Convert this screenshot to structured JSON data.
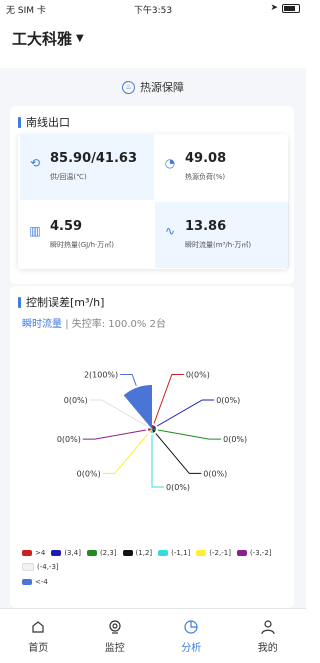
{
  "status": {
    "carrier": "无 SIM 卡",
    "time": "下午3:53"
  },
  "header": {
    "title": "工大科雅"
  },
  "section": {
    "title": "热源保障"
  },
  "station": {
    "title": "南线出口",
    "metrics": [
      {
        "value": "85.90/41.63",
        "label": "供/回温(℃)",
        "icon": "refresh-icon"
      },
      {
        "value": "49.08",
        "label": "热源负荷(%)",
        "icon": "gauge-icon"
      },
      {
        "value": "4.59",
        "label": "瞬时热量(GJ/h·万㎡)",
        "icon": "bar-chart-icon"
      },
      {
        "value": "13.86",
        "label": "瞬时流量(m³/h·万㎡)",
        "icon": "pulse-icon"
      }
    ]
  },
  "control": {
    "title": "控制误差[m³/h]",
    "subtitle_active": "瞬时流量",
    "subtitle_rest": "| 失控率: 100.0% 2台"
  },
  "chart_data": {
    "type": "pie",
    "title": "控制误差[m³/h]",
    "categories": [
      ">4",
      "(3,4]",
      "(2,3]",
      "(1,2]",
      "(-1,1]",
      "(-2,-1]",
      "(-3,-2]",
      "(-4,-3]",
      "<-4"
    ],
    "values": [
      0,
      0,
      0,
      0,
      0,
      0,
      0,
      0,
      2
    ],
    "labels": [
      "0(0%)",
      "0(0%)",
      "0(0%)",
      "0(0%)",
      "0(0%)",
      "0(0%)",
      "0(0%)",
      "0(0%)",
      "2(100%)"
    ],
    "colors": [
      "#cc1f1f",
      "#1c1cb0",
      "#1f8a1f",
      "#111111",
      "#33dddd",
      "#ffee33",
      "#8a1f8a",
      "#f2f2f2",
      "#4a74d6"
    ],
    "legend_position": "bottom"
  },
  "tabs": [
    {
      "label": "首页"
    },
    {
      "label": "监控"
    },
    {
      "label": "分析"
    },
    {
      "label": "我的"
    }
  ]
}
